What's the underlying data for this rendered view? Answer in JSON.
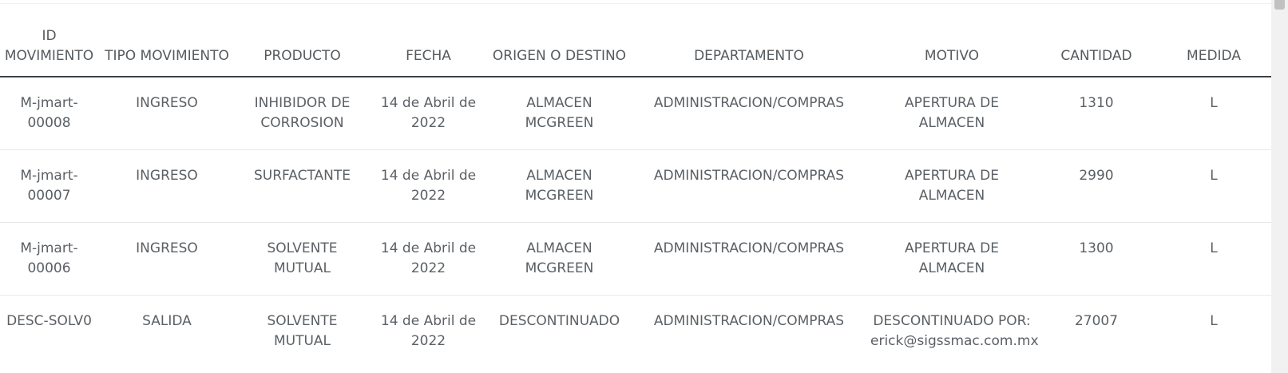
{
  "table": {
    "headers": {
      "id": "ID MOVIMIENTO",
      "tipo": "TIPO MOVIMIENTO",
      "producto": "PRODUCTO",
      "fecha": "FECHA",
      "origen": "ORIGEN O DESTINO",
      "departamento": "DEPARTAMENTO",
      "motivo": "MOTIVO",
      "cantidad": "CANTIDAD",
      "medida": "MEDIDA"
    },
    "rows": [
      {
        "id": "M-jmart-00008",
        "tipo": "INGRESO",
        "producto": "INHIBIDOR DE CORROSION",
        "fecha": "14 de Abril de 2022",
        "origen": "ALMACEN MCGREEN",
        "departamento": "ADMINISTRACION/COMPRAS",
        "motivo": "APERTURA DE ALMACEN",
        "cantidad": "1310",
        "medida": "L"
      },
      {
        "id": "M-jmart-00007",
        "tipo": "INGRESO",
        "producto": "SURFACTANTE",
        "fecha": "14 de Abril de 2022",
        "origen": "ALMACEN MCGREEN",
        "departamento": "ADMINISTRACION/COMPRAS",
        "motivo": "APERTURA DE ALMACEN",
        "cantidad": "2990",
        "medida": "L"
      },
      {
        "id": "M-jmart-00006",
        "tipo": "INGRESO",
        "producto": "SOLVENTE MUTUAL",
        "fecha": "14 de Abril de 2022",
        "origen": "ALMACEN MCGREEN",
        "departamento": "ADMINISTRACION/COMPRAS",
        "motivo": "APERTURA DE ALMACEN",
        "cantidad": "1300",
        "medida": "L"
      },
      {
        "id": "DESC-SOLV0",
        "tipo": "SALIDA",
        "producto": "SOLVENTE MUTUAL",
        "fecha": "14 de Abril de 2022",
        "origen": "DESCONTINUADO",
        "departamento": "ADMINISTRACION/COMPRAS",
        "motivo": "DESCONTINUADO POR: erick@sigssmac.com.mx",
        "cantidad": "27007",
        "medida": "L"
      }
    ]
  }
}
